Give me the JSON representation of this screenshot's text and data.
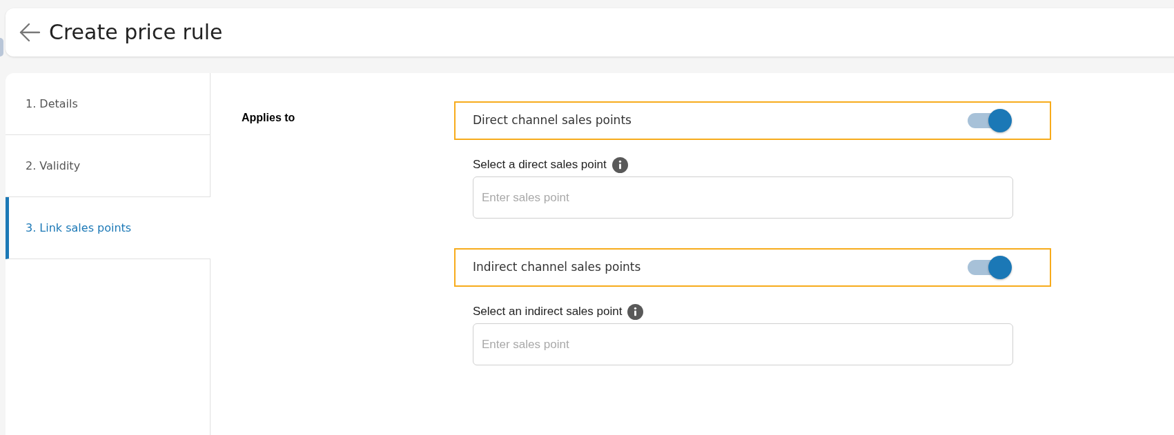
{
  "header": {
    "title": "Create price rule"
  },
  "steps": [
    {
      "label": "1. Details",
      "selected": false
    },
    {
      "label": "2. Validity",
      "selected": false
    },
    {
      "label": "3. Link sales points",
      "selected": true
    }
  ],
  "form": {
    "label": "Applies to",
    "channels": [
      {
        "title": "Direct channel sales points",
        "on": true,
        "highlighted": true,
        "field_label": "Select a direct sales point",
        "placeholder": "Enter sales point"
      },
      {
        "title": "Indirect channel sales points",
        "on": true,
        "highlighted": true,
        "field_label": "Select an indirect sales point",
        "placeholder": "Enter sales point"
      }
    ]
  }
}
